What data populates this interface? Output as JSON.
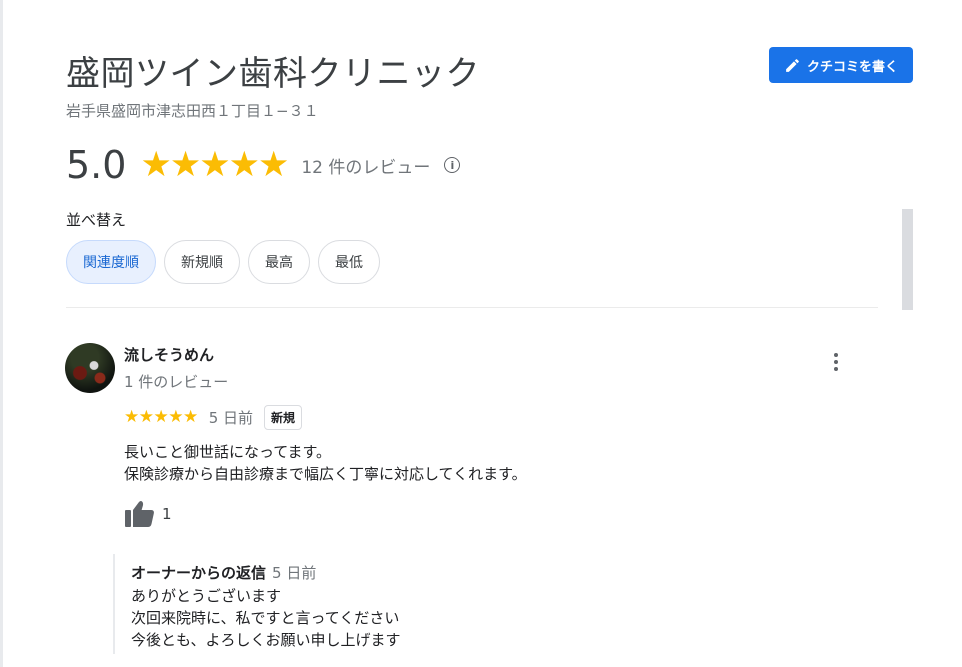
{
  "place": {
    "name": "盛岡ツイン歯科クリニック",
    "address": "岩手県盛岡市津志田西１丁目１−３１"
  },
  "write_review_button": {
    "label": "クチコミを書く",
    "icon": "pencil-icon"
  },
  "rating": {
    "score": "5.0",
    "stars": "★★★★★",
    "star_value": 5,
    "review_count_label": "12 件のレビュー",
    "info_icon": "info-icon"
  },
  "sort": {
    "label": "並べ替え",
    "options": [
      "関連度順",
      "新規順",
      "最高",
      "最低"
    ],
    "selected": "関連度順"
  },
  "colors": {
    "accent": "#1a73e8",
    "star": "#fbbc04",
    "chip_selected_bg": "#e8f0fe",
    "chip_selected_text": "#1967d2"
  },
  "reviews": [
    {
      "author": "流しそうめん",
      "author_review_count": "1 件のレビュー",
      "stars": "★★★★★",
      "star_value": 5,
      "time": "5 日前",
      "badge": "新規",
      "text_lines": [
        "長いこと御世話になってます。",
        "保険診療から自由診療まで幅広く丁寧に対応してくれます。"
      ],
      "likes": "1",
      "owner_reply": {
        "label": "オーナーからの返信",
        "time": "5 日前",
        "text_lines": [
          "ありがとうございます",
          "次回来院時に、私ですと言ってください",
          "今後とも、よろしくお願い申し上げます"
        ]
      }
    }
  ]
}
